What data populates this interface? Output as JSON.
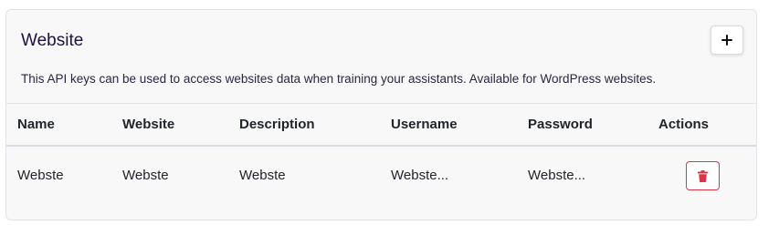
{
  "card": {
    "title": "Website",
    "description": "This API keys can be used to access websites data when training your assistants. Available for WordPress websites.",
    "add_button_icon": "plus-icon"
  },
  "table": {
    "columns": [
      "Name",
      "Website",
      "Description",
      "Username",
      "Password",
      "Actions"
    ],
    "rows": [
      {
        "name": "Webste",
        "website": "Webste",
        "description": "Webste",
        "username": "Webste...",
        "password": "Webste...",
        "action_icon": "trash-icon"
      }
    ]
  },
  "colors": {
    "danger": "#dc3545",
    "title": "#1f1140"
  }
}
